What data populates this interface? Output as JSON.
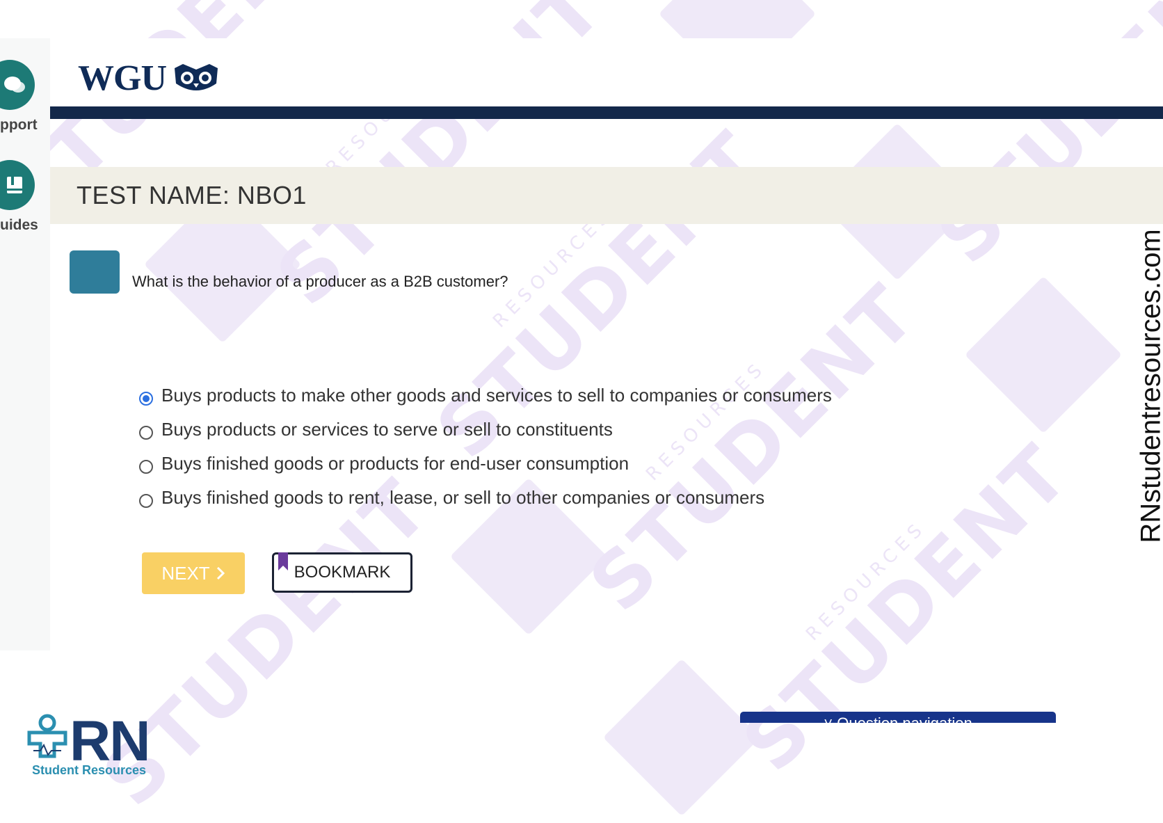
{
  "sidebar": {
    "support_label": "pport",
    "guides_label": "uides"
  },
  "header": {
    "logo_text": "WGU"
  },
  "test": {
    "name_label": "TEST NAME:  NBO1"
  },
  "question": {
    "text": "What is the behavior of a producer as a B2B customer?",
    "options": [
      {
        "label": "Buys products to make other goods and services to sell to companies or consumers",
        "selected": true
      },
      {
        "label": "Buys products or services to serve or sell to constituents",
        "selected": false
      },
      {
        "label": "Buys finished goods or products for end-user consumption",
        "selected": false
      },
      {
        "label": "Buys finished goods to rent, lease, or sell to other companies or consumers",
        "selected": false
      }
    ]
  },
  "buttons": {
    "next_label": "NEXT",
    "bookmark_label": "BOOKMARK"
  },
  "navigation": {
    "question_nav_label": "˅ Question navigation"
  },
  "branding": {
    "rn_letters": "RN",
    "rn_sub": "Student Resources",
    "site_text": "RNstudentresources.com",
    "watermark_text": "STUDENT",
    "watermark_sub": "RESOURCES"
  },
  "colors": {
    "header_bar": "#13284a",
    "teal": "#1d7a76",
    "next_button": "#f8c84a",
    "radio_selected": "#2b6fe0",
    "qnav": "#17348a"
  }
}
